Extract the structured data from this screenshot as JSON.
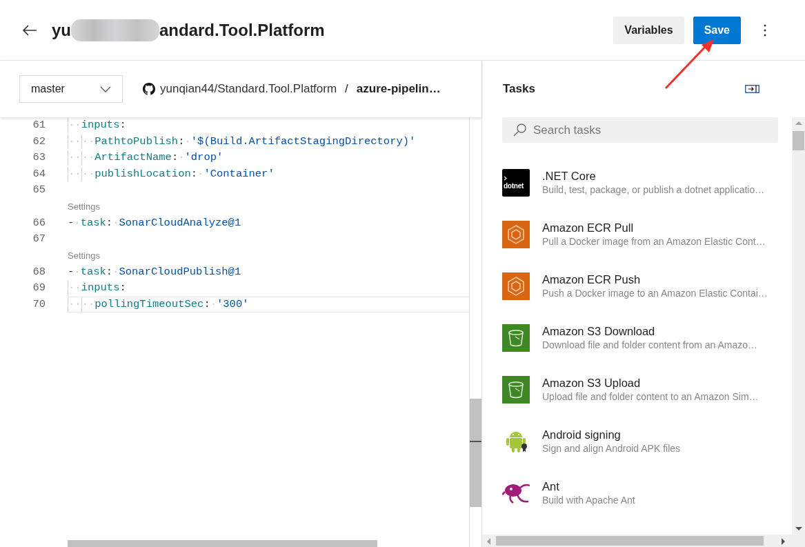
{
  "header": {
    "title_start": "yu",
    "title_end": "andard.Tool.Platform",
    "buttons": [
      {
        "label": "Variables",
        "kind": "secondary"
      },
      {
        "label": "Save",
        "kind": "primary"
      }
    ]
  },
  "toolbar": {
    "branch": "master",
    "repo": "yunqian44/Standard.Tool.Platform",
    "separator": "/",
    "file": "azure-pipelin…"
  },
  "editor": {
    "lines": [
      {
        "kind": "code",
        "number": "61",
        "tokens": [
          {
            "kind": "whitespace",
            "text": "··"
          },
          {
            "kind": "key",
            "text": "inputs"
          },
          {
            "kind": "punct",
            "text": ":"
          }
        ]
      },
      {
        "kind": "code",
        "number": "62",
        "tokens": [
          {
            "kind": "whitespace",
            "text": "····"
          },
          {
            "kind": "key",
            "text": "PathtoPublish"
          },
          {
            "kind": "punct",
            "text": ":"
          },
          {
            "kind": "whitespace",
            "text": "·"
          },
          {
            "kind": "string",
            "text": "'$(Build.ArtifactStagingDirectory)'"
          }
        ]
      },
      {
        "kind": "code",
        "number": "63",
        "tokens": [
          {
            "kind": "whitespace",
            "text": "····"
          },
          {
            "kind": "key",
            "text": "ArtifactName"
          },
          {
            "kind": "punct",
            "text": ":"
          },
          {
            "kind": "whitespace",
            "text": "·"
          },
          {
            "kind": "string",
            "text": "'drop'"
          }
        ]
      },
      {
        "kind": "code",
        "number": "64",
        "tokens": [
          {
            "kind": "whitespace",
            "text": "····"
          },
          {
            "kind": "key",
            "text": "publishLocation"
          },
          {
            "kind": "punct",
            "text": ":"
          },
          {
            "kind": "whitespace",
            "text": "·"
          },
          {
            "kind": "string",
            "text": "'Container'"
          }
        ]
      },
      {
        "kind": "code",
        "number": "65"
      },
      {
        "kind": "codelens",
        "text": "Settings"
      },
      {
        "kind": "code",
        "number": "66",
        "tokens": [
          {
            "kind": "punct",
            "text": "-"
          },
          {
            "kind": "whitespace",
            "text": "·"
          },
          {
            "kind": "key",
            "text": "task"
          },
          {
            "kind": "punct",
            "text": ":"
          },
          {
            "kind": "whitespace",
            "text": "·"
          },
          {
            "kind": "string",
            "text": "SonarCloudAnalyze@1"
          }
        ]
      },
      {
        "kind": "code",
        "number": "67"
      },
      {
        "kind": "codelens",
        "text": "Settings"
      },
      {
        "kind": "code",
        "number": "68",
        "tokens": [
          {
            "kind": "punct",
            "text": "-"
          },
          {
            "kind": "whitespace",
            "text": "·"
          },
          {
            "kind": "key",
            "text": "task"
          },
          {
            "kind": "punct",
            "text": ":"
          },
          {
            "kind": "whitespace",
            "text": "·"
          },
          {
            "kind": "string",
            "text": "SonarCloudPublish@1"
          }
        ]
      },
      {
        "kind": "code",
        "number": "69",
        "tokens": [
          {
            "kind": "whitespace",
            "text": "··"
          },
          {
            "kind": "key",
            "text": "inputs"
          },
          {
            "kind": "punct",
            "text": ":"
          }
        ]
      },
      {
        "kind": "code",
        "number": "70",
        "tokens": [
          {
            "kind": "whitespace",
            "text": "····"
          },
          {
            "kind": "key",
            "text": "pollingTimeoutSec"
          },
          {
            "kind": "punct",
            "text": ":"
          },
          {
            "kind": "whitespace",
            "text": "·"
          },
          {
            "kind": "string",
            "text": "'300'"
          }
        ],
        "current": true
      }
    ]
  },
  "tasks": {
    "title": "Tasks",
    "search": {
      "placeholder": "Search tasks"
    },
    "items": [
      {
        "name": ".NET Core",
        "description": "Build, test, package, or publish a dotnet applicatio…",
        "kind": "dotnet",
        "icon_text": "dotnet"
      },
      {
        "name": "Amazon ECR Pull",
        "description": "Pull a Docker image from an Amazon Elastic Cont…",
        "kind": "ecr"
      },
      {
        "name": "Amazon ECR Push",
        "description": "Push a Docker image to an Amazon Elastic Contai…",
        "kind": "ecr"
      },
      {
        "name": "Amazon S3 Download",
        "description": "Download file and folder content from an Amazo…",
        "kind": "s3"
      },
      {
        "name": "Amazon S3 Upload",
        "description": "Upload file and folder content to an Amazon Sim…",
        "kind": "s3"
      },
      {
        "name": "Android signing",
        "description": "Sign and align Android APK files",
        "kind": "android"
      },
      {
        "name": "Ant",
        "description": "Build with Apache Ant",
        "kind": "ant"
      }
    ]
  }
}
